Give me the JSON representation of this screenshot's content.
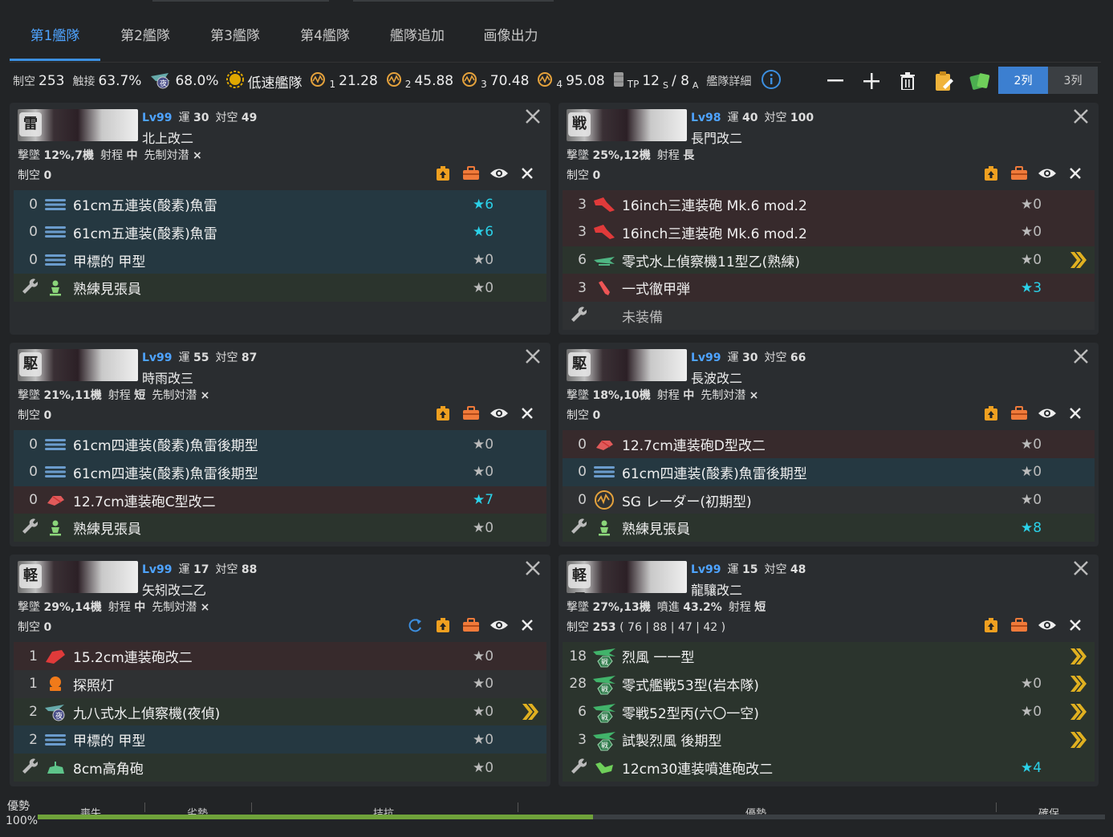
{
  "tabs": [
    {
      "label": "第1艦隊"
    },
    {
      "label": "第2艦隊"
    },
    {
      "label": "第3艦隊"
    },
    {
      "label": "第4艦隊"
    },
    {
      "label": "艦隊追加"
    },
    {
      "label": "画像出力"
    }
  ],
  "stats": {
    "air_label": "制空",
    "air_value": "253",
    "contact_label": "触接",
    "contact_value": "63.7%",
    "night_contact_value": "68.0%",
    "speed_label": "低速艦隊",
    "los": [
      {
        "idx": "1",
        "value": "21.28"
      },
      {
        "idx": "2",
        "value": "45.88"
      },
      {
        "idx": "3",
        "value": "70.48"
      },
      {
        "idx": "4",
        "value": "95.08"
      }
    ],
    "tp_label": "TP",
    "tp_s": "12",
    "tp_s_sub": "S",
    "tp_sep": "/ 8",
    "tp_a_sub": "A",
    "detail_label": "艦隊詳細"
  },
  "colswitch": {
    "two": "2列",
    "three": "3列"
  },
  "ships": [
    {
      "tag": "雷",
      "level": "Lv99",
      "luck_label": "運",
      "luck": "30",
      "aa_label": "対空",
      "aa": "49",
      "name": "北上改二",
      "shootdown_label": "撃墜",
      "shootdown": "12%,7機",
      "range_label": "射程",
      "range": "中",
      "oasw_label": "先制対潜",
      "oasw": "×",
      "air_label": "制空",
      "air": "0",
      "air_extra": "",
      "equips": [
        {
          "slot": "0",
          "icon": "torpedo-icon",
          "name": "61cm五連装(酸素)魚雷",
          "star": "★6",
          "hi": true,
          "bg": "blue",
          "prof": ""
        },
        {
          "slot": "0",
          "icon": "torpedo-icon",
          "name": "61cm五連装(酸素)魚雷",
          "star": "★6",
          "hi": true,
          "bg": "blue",
          "prof": ""
        },
        {
          "slot": "0",
          "icon": "torpedo-icon",
          "name": "甲標的 甲型",
          "star": "★0",
          "hi": false,
          "bg": "blue",
          "prof": ""
        },
        {
          "slot": "",
          "icon": "lookout-icon",
          "name": "熟練見張員",
          "star": "★0",
          "hi": false,
          "bg": "green",
          "prof": "",
          "ex": true
        }
      ]
    },
    {
      "tag": "戦",
      "level": "Lv98",
      "luck_label": "運",
      "luck": "40",
      "aa_label": "対空",
      "aa": "100",
      "name": "長門改二",
      "shootdown_label": "撃墜",
      "shootdown": "25%,12機",
      "range_label": "射程",
      "range": "長",
      "oasw_label": "",
      "oasw": "",
      "air_label": "制空",
      "air": "0",
      "air_extra": "",
      "equips": [
        {
          "slot": "3",
          "icon": "big-gun-icon",
          "name": "16inch三連装砲 Mk.6 mod.2",
          "star": "★0",
          "hi": false,
          "bg": "red",
          "prof": ""
        },
        {
          "slot": "3",
          "icon": "big-gun-icon",
          "name": "16inch三連装砲 Mk.6 mod.2",
          "star": "★0",
          "hi": false,
          "bg": "red",
          "prof": ""
        },
        {
          "slot": "6",
          "icon": "seaplane-icon",
          "name": "零式水上偵察機11型乙(熟練)",
          "star": "★0",
          "hi": false,
          "bg": "green",
          "prof": ">>"
        },
        {
          "slot": "3",
          "icon": "ap-shell-icon",
          "name": "一式徹甲弾",
          "star": "★3",
          "hi": true,
          "bg": "red",
          "prof": ""
        },
        {
          "slot": "",
          "icon": "",
          "name": "未装備",
          "star": "",
          "hi": false,
          "bg": "gray",
          "prof": "",
          "ex": true,
          "dim": true
        }
      ]
    },
    {
      "tag": "駆",
      "level": "Lv99",
      "luck_label": "運",
      "luck": "55",
      "aa_label": "対空",
      "aa": "87",
      "name": "時雨改三",
      "shootdown_label": "撃墜",
      "shootdown": "21%,11機",
      "range_label": "射程",
      "range": "短",
      "oasw_label": "先制対潜",
      "oasw": "×",
      "air_label": "制空",
      "air": "0",
      "air_extra": "",
      "equips": [
        {
          "slot": "0",
          "icon": "torpedo-icon",
          "name": "61cm四連装(酸素)魚雷後期型",
          "star": "★0",
          "hi": false,
          "bg": "blue",
          "prof": ""
        },
        {
          "slot": "0",
          "icon": "torpedo-icon",
          "name": "61cm四連装(酸素)魚雷後期型",
          "star": "★0",
          "hi": false,
          "bg": "blue",
          "prof": ""
        },
        {
          "slot": "0",
          "icon": "small-gun-icon",
          "name": "12.7cm連装砲C型改二",
          "star": "★7",
          "hi": true,
          "bg": "red",
          "prof": ""
        },
        {
          "slot": "",
          "icon": "lookout-icon",
          "name": "熟練見張員",
          "star": "★0",
          "hi": false,
          "bg": "green",
          "prof": "",
          "ex": true
        }
      ]
    },
    {
      "tag": "駆",
      "level": "Lv99",
      "luck_label": "運",
      "luck": "30",
      "aa_label": "対空",
      "aa": "66",
      "name": "長波改二",
      "shootdown_label": "撃墜",
      "shootdown": "18%,10機",
      "range_label": "射程",
      "range": "中",
      "oasw_label": "先制対潜",
      "oasw": "×",
      "air_label": "制空",
      "air": "0",
      "air_extra": "",
      "equips": [
        {
          "slot": "0",
          "icon": "small-gun-icon",
          "name": "12.7cm連装砲D型改二",
          "star": "★0",
          "hi": false,
          "bg": "red",
          "prof": ""
        },
        {
          "slot": "0",
          "icon": "torpedo-icon",
          "name": "61cm四連装(酸素)魚雷後期型",
          "star": "★0",
          "hi": false,
          "bg": "blue",
          "prof": ""
        },
        {
          "slot": "0",
          "icon": "radar-icon",
          "name": "SG レーダー(初期型)",
          "star": "★0",
          "hi": false,
          "bg": "gray",
          "prof": ""
        },
        {
          "slot": "",
          "icon": "lookout-icon",
          "name": "熟練見張員",
          "star": "★8",
          "hi": true,
          "bg": "green",
          "prof": "",
          "ex": true
        }
      ]
    },
    {
      "tag": "軽",
      "level": "Lv99",
      "luck_label": "運",
      "luck": "17",
      "aa_label": "対空",
      "aa": "88",
      "name": "矢矧改二乙",
      "shootdown_label": "撃墜",
      "shootdown": "29%,14機",
      "range_label": "射程",
      "range": "中",
      "oasw_label": "先制対潜",
      "oasw": "×",
      "air_label": "制空",
      "air": "0",
      "air_extra": "",
      "equips": [
        {
          "slot": "1",
          "icon": "medium-gun-icon",
          "name": "15.2cm連装砲改二",
          "star": "★0",
          "hi": false,
          "bg": "red",
          "prof": ""
        },
        {
          "slot": "1",
          "icon": "searchlight-icon",
          "name": "探照灯",
          "star": "★0",
          "hi": false,
          "bg": "gray",
          "prof": ""
        },
        {
          "slot": "2",
          "icon": "night-seaplane-icon",
          "name": "九八式水上偵察機(夜偵)",
          "star": "★0",
          "hi": false,
          "bg": "green",
          "prof": ">>"
        },
        {
          "slot": "2",
          "icon": "torpedo-icon",
          "name": "甲標的 甲型",
          "star": "★0",
          "hi": false,
          "bg": "blue",
          "prof": ""
        },
        {
          "slot": "",
          "icon": "aa-gun-icon",
          "name": "8cm高角砲",
          "star": "★0",
          "hi": false,
          "bg": "green",
          "prof": "",
          "ex": true
        }
      ]
    },
    {
      "tag": "軽母",
      "level": "Lv99",
      "luck_label": "運",
      "luck": "15",
      "aa_label": "対空",
      "aa": "48",
      "name": "龍驤改二",
      "shootdown_label": "撃墜",
      "shootdown": "27%,13機",
      "range_label": "噴進",
      "range": "43.2%",
      "oasw_label": "射程",
      "oasw": "短",
      "air_label": "制空",
      "air": "253",
      "air_extra": "( 76 | 88 | 47 | 42 )",
      "equips": [
        {
          "slot": "18",
          "icon": "fighter-icon",
          "name": "烈風 一一型",
          "star": "",
          "hi": false,
          "bg": "green",
          "prof": ">>"
        },
        {
          "slot": "28",
          "icon": "fighter-icon",
          "name": "零式艦戦53型(岩本隊)",
          "star": "★0",
          "hi": false,
          "bg": "green",
          "prof": ">>"
        },
        {
          "slot": "6",
          "icon": "fighter-icon",
          "name": "零戦52型丙(六〇一空)",
          "star": "★0",
          "hi": false,
          "bg": "green",
          "prof": ">>"
        },
        {
          "slot": "3",
          "icon": "fighter-icon",
          "name": "試製烈風 後期型",
          "star": "",
          "hi": false,
          "bg": "green",
          "prof": ">>"
        },
        {
          "slot": "",
          "icon": "rocket-icon",
          "name": "12cm30連装噴進砲改二",
          "star": "★4",
          "hi": true,
          "bg": "green",
          "prof": "",
          "ex": true
        }
      ]
    }
  ],
  "airbar": {
    "left_label": "優勢",
    "percent": "100%",
    "segments": [
      "喪失",
      "劣勢",
      "拮抗",
      "優勢",
      "確保"
    ],
    "fill_fraction": 0.52
  }
}
